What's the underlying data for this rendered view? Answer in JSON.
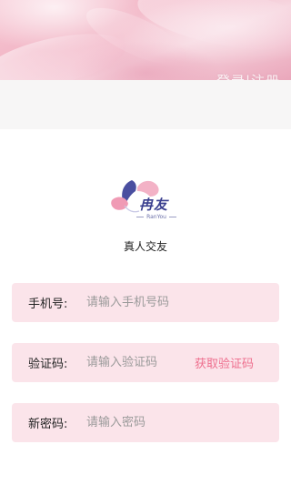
{
  "header": {
    "overlay_text": "登录|注册"
  },
  "brand": {
    "name": "冉友",
    "subtitle": "RanYou",
    "tagline": "真人交友",
    "colors": {
      "navy": "#3a3f8f",
      "pink": "#f09bb5",
      "light_pink": "#f7c9d6"
    }
  },
  "form": {
    "phone": {
      "label": "手机号:",
      "placeholder": "请输入手机号码",
      "value": ""
    },
    "code": {
      "label": "验证码:",
      "placeholder": "请输入验证码",
      "value": "",
      "action": "获取验证码"
    },
    "password": {
      "label": "新密码:",
      "placeholder": "请输入密码",
      "value": ""
    }
  },
  "theme": {
    "field_bg": "#fbe4ea",
    "accent": "#ee6f8e"
  }
}
